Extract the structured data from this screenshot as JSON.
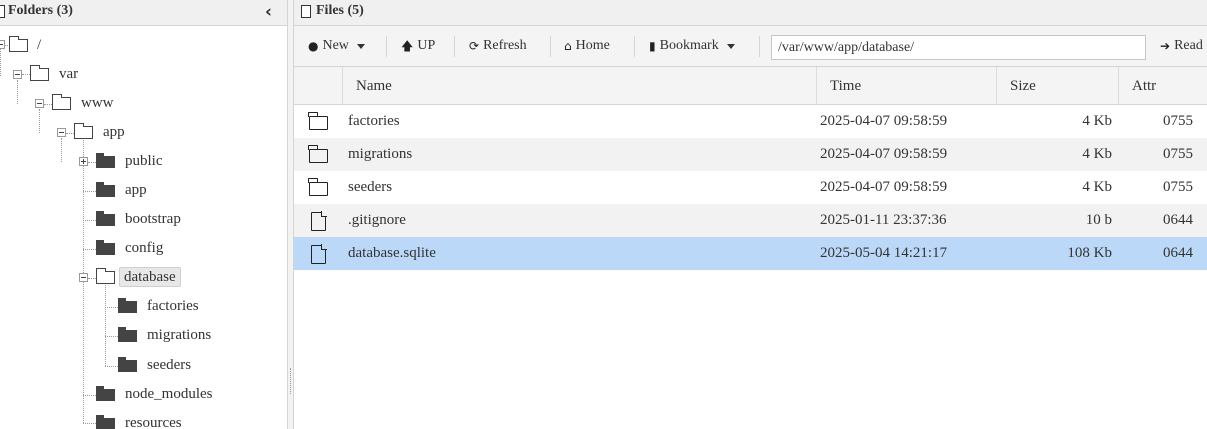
{
  "left_panel": {
    "title": "Folders (3)",
    "collapse_glyph": "‹",
    "tree": [
      {
        "label": "/",
        "icon": "folder-open-icon",
        "toggle": "minus"
      },
      {
        "label": "var",
        "icon": "folder-open-icon",
        "toggle": "minus"
      },
      {
        "label": "www",
        "icon": "folder-open-icon",
        "toggle": "minus"
      },
      {
        "label": "app",
        "icon": "folder-open-icon",
        "toggle": "minus"
      },
      {
        "label": "public",
        "icon": "folder-icon",
        "toggle": "plus"
      },
      {
        "label": "app",
        "icon": "folder-icon"
      },
      {
        "label": "bootstrap",
        "icon": "folder-icon"
      },
      {
        "label": "config",
        "icon": "folder-icon"
      },
      {
        "label": "database",
        "icon": "folder-open-icon",
        "toggle": "minus",
        "selected": true
      },
      {
        "label": "factories",
        "icon": "folder-icon"
      },
      {
        "label": "migrations",
        "icon": "folder-icon"
      },
      {
        "label": "seeders",
        "icon": "folder-icon"
      },
      {
        "label": "node_modules",
        "icon": "folder-icon"
      },
      {
        "label": "resources",
        "icon": "folder-icon"
      }
    ]
  },
  "right_panel": {
    "title": "Files (5)",
    "toolbar": {
      "new_label": "New",
      "up_label": "UP",
      "refresh_label": "Refresh",
      "home_label": "Home",
      "bookmark_label": "Bookmark",
      "path_value": "/var/www/app/database/",
      "read_label": "Read"
    },
    "columns": [
      "Name",
      "Time",
      "Size",
      "Attr"
    ],
    "rows": [
      {
        "icon": "folder-icon",
        "name": "factories",
        "time": "2025-04-07 09:58:59",
        "size": "4 Kb",
        "attr": "0755"
      },
      {
        "icon": "folder-icon",
        "name": "migrations",
        "time": "2025-04-07 09:58:59",
        "size": "4 Kb",
        "attr": "0755"
      },
      {
        "icon": "folder-icon",
        "name": "seeders",
        "time": "2025-04-07 09:58:59",
        "size": "4 Kb",
        "attr": "0755"
      },
      {
        "icon": "file-icon",
        "name": ".gitignore",
        "time": "2025-01-11 23:37:36",
        "size": "10 b",
        "attr": "0644"
      },
      {
        "icon": "file-icon",
        "name": "database.sqlite",
        "time": "2025-05-04 14:21:17",
        "size": "108 Kb",
        "attr": "0644",
        "selected": true
      }
    ]
  },
  "colors": {
    "selected_row": "#bcd8f9",
    "header_bg": "#f0f0f0",
    "striped_row": "#f2f2f2",
    "text": "#333333"
  }
}
